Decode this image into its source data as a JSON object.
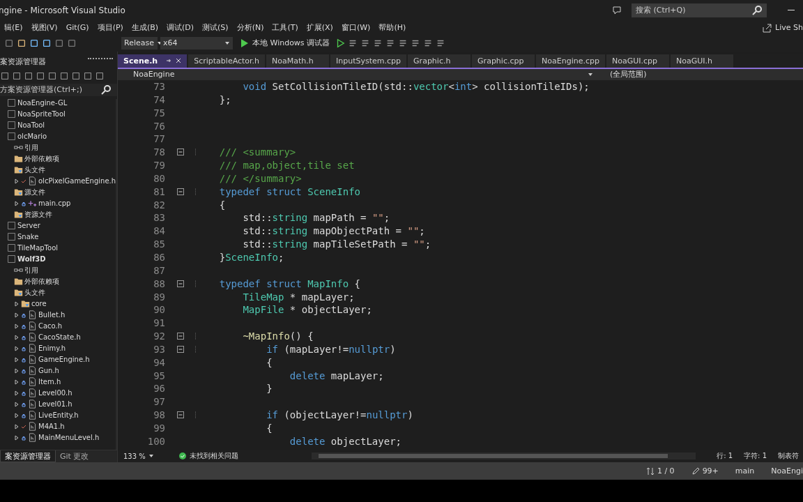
{
  "window": {
    "title": "ngine - Microsoft Visual Studio",
    "search_placeholder": "搜索 (Ctrl+Q)",
    "live_share": "Live Sh"
  },
  "menu": [
    "辑(E)",
    "视图(V)",
    "Git(G)",
    "项目(P)",
    "生成(B)",
    "调试(D)",
    "测试(S)",
    "分析(N)",
    "工具(T)",
    "扩展(X)",
    "窗口(W)",
    "帮助(H)"
  ],
  "toolbar": {
    "configuration": "Release",
    "platform": "x64",
    "debugger": "本地 Windows 调试器"
  },
  "solution_explorer": {
    "title": "案资源管理器",
    "search_placeholder": "方案资源管理器(Ctrl+;)",
    "items": [
      {
        "label": "NoaEngine-GL",
        "kind": "project",
        "startup": false
      },
      {
        "label": "NoaSpriteTool",
        "kind": "project",
        "startup": false
      },
      {
        "label": "NoaTool",
        "kind": "project",
        "startup": false
      },
      {
        "label": "olcMario",
        "kind": "project",
        "startup": false,
        "children": [
          {
            "label": "引用",
            "kind": "ref"
          },
          {
            "label": "外部依赖项",
            "kind": "extdep"
          },
          {
            "label": "头文件",
            "kind": "folder",
            "children": [
              {
                "label": "olcPixelGameEngine.h",
                "kind": "header",
                "locked": false
              }
            ]
          },
          {
            "label": "源文件",
            "kind": "folder",
            "children": [
              {
                "label": "main.cpp",
                "kind": "source",
                "locked": true
              }
            ]
          },
          {
            "label": "资源文件",
            "kind": "folder"
          }
        ]
      },
      {
        "label": "Server",
        "kind": "project",
        "startup": false
      },
      {
        "label": "Snake",
        "kind": "project",
        "startup": false
      },
      {
        "label": "TileMapTool",
        "kind": "project",
        "startup": false
      },
      {
        "label": "Wolf3D",
        "kind": "project",
        "startup": true,
        "children": [
          {
            "label": "引用",
            "kind": "ref"
          },
          {
            "label": "外部依赖项",
            "kind": "extdep"
          },
          {
            "label": "头文件",
            "kind": "folder",
            "children": [
              {
                "label": "core",
                "kind": "folder"
              },
              {
                "label": "Bullet.h",
                "kind": "header",
                "locked": true
              },
              {
                "label": "Caco.h",
                "kind": "header",
                "locked": true
              },
              {
                "label": "CacoState.h",
                "kind": "header",
                "locked": true
              },
              {
                "label": "Enimy.h",
                "kind": "header",
                "locked": true
              },
              {
                "label": "GameEngine.h",
                "kind": "header",
                "locked": true
              },
              {
                "label": "Gun.h",
                "kind": "header",
                "locked": true
              },
              {
                "label": "Item.h",
                "kind": "header",
                "locked": true
              },
              {
                "label": "Level00.h",
                "kind": "header",
                "locked": true
              },
              {
                "label": "Level01.h",
                "kind": "header",
                "locked": true
              },
              {
                "label": "LiveEntity.h",
                "kind": "header",
                "locked": true
              },
              {
                "label": "M4A1.h",
                "kind": "header",
                "locked": false
              },
              {
                "label": "MainMenuLevel.h",
                "kind": "header",
                "locked": true
              }
            ]
          }
        ]
      }
    ],
    "bottom_tabs": [
      {
        "label": "案资源管理器",
        "selected": true
      },
      {
        "label": "Git 更改",
        "selected": false
      }
    ]
  },
  "tabs": [
    {
      "label": "Scene.h",
      "selected": true
    },
    {
      "label": "ScriptableActor.h",
      "selected": false
    },
    {
      "label": "NoaMath.h",
      "selected": false
    },
    {
      "label": "InputSystem.cpp",
      "selected": false
    },
    {
      "label": "Graphic.h",
      "selected": false
    },
    {
      "label": "Graphic.cpp",
      "selected": false
    },
    {
      "label": "NoaEngine.cpp",
      "selected": false
    },
    {
      "label": "NoaGUI.cpp",
      "selected": false
    },
    {
      "label": "NoaGUI.h",
      "selected": false
    }
  ],
  "navigation": {
    "project": "NoaEngine",
    "scope": "(全局范围)"
  },
  "code_lines": [
    {
      "number": "73",
      "fold": false,
      "tokens": [
        {
          "kind": "keyword",
          "text": "        void"
        },
        {
          "kind": "plain",
          "text": " SetCollisionTileID(std::"
        },
        {
          "kind": "type",
          "text": "vector"
        },
        {
          "kind": "plain",
          "text": "<"
        },
        {
          "kind": "keyword",
          "text": "int"
        },
        {
          "kind": "plain",
          "text": "> collisionTileIDs);"
        }
      ]
    },
    {
      "number": "74",
      "fold": false,
      "tokens": [
        {
          "kind": "plain",
          "text": "    };"
        }
      ]
    },
    {
      "number": "75",
      "fold": false
    },
    {
      "number": "76",
      "fold": false
    },
    {
      "number": "77",
      "fold": false
    },
    {
      "number": "78",
      "fold": true,
      "tokens": [
        {
          "kind": "comment",
          "text": "    /// <summary>"
        }
      ]
    },
    {
      "number": "79",
      "fold": false,
      "tokens": [
        {
          "kind": "comment",
          "text": "    /// map,object,tile set"
        }
      ]
    },
    {
      "number": "80",
      "fold": false,
      "tokens": [
        {
          "kind": "comment",
          "text": "    /// </summary>"
        }
      ]
    },
    {
      "number": "81",
      "fold": true,
      "tokens": [
        {
          "kind": "keyword",
          "text": "    typedef struct"
        },
        {
          "kind": "type",
          "text": " SceneInfo"
        }
      ]
    },
    {
      "number": "82",
      "fold": false,
      "tokens": [
        {
          "kind": "plain",
          "text": "    {"
        }
      ]
    },
    {
      "number": "83",
      "fold": false,
      "tokens": [
        {
          "kind": "plain",
          "text": "        std::"
        },
        {
          "kind": "type",
          "text": "string"
        },
        {
          "kind": "plain",
          "text": " mapPath = "
        },
        {
          "kind": "string",
          "text": "\"\""
        },
        {
          "kind": "plain",
          "text": ";"
        }
      ]
    },
    {
      "number": "84",
      "fold": false,
      "tokens": [
        {
          "kind": "plain",
          "text": "        std::"
        },
        {
          "kind": "type",
          "text": "string"
        },
        {
          "kind": "plain",
          "text": " mapObjectPath = "
        },
        {
          "kind": "string",
          "text": "\"\""
        },
        {
          "kind": "plain",
          "text": ";"
        }
      ]
    },
    {
      "number": "85",
      "fold": false,
      "tokens": [
        {
          "kind": "plain",
          "text": "        std::"
        },
        {
          "kind": "type",
          "text": "string"
        },
        {
          "kind": "plain",
          "text": " mapTileSetPath = "
        },
        {
          "kind": "string",
          "text": "\"\""
        },
        {
          "kind": "plain",
          "text": ";"
        }
      ]
    },
    {
      "number": "86",
      "fold": false,
      "tokens": [
        {
          "kind": "plain",
          "text": "    }"
        },
        {
          "kind": "type",
          "text": "SceneInfo"
        },
        {
          "kind": "plain",
          "text": ";"
        }
      ]
    },
    {
      "number": "87",
      "fold": false
    },
    {
      "number": "88",
      "fold": true,
      "tokens": [
        {
          "kind": "keyword",
          "text": "    typedef struct"
        },
        {
          "kind": "type",
          "text": " MapInfo"
        },
        {
          "kind": "plain",
          "text": " {"
        }
      ]
    },
    {
      "number": "89",
      "fold": false,
      "tokens": [
        {
          "kind": "type",
          "text": "        TileMap"
        },
        {
          "kind": "plain",
          "text": " * mapLayer;"
        }
      ]
    },
    {
      "number": "90",
      "fold": false,
      "tokens": [
        {
          "kind": "type",
          "text": "        MapFile"
        },
        {
          "kind": "plain",
          "text": " * objectLayer;"
        }
      ]
    },
    {
      "number": "91",
      "fold": false
    },
    {
      "number": "92",
      "fold": true,
      "tokens": [
        {
          "kind": "function",
          "text": "        ~MapInfo"
        },
        {
          "kind": "plain",
          "text": "() {"
        }
      ]
    },
    {
      "number": "93",
      "fold": true,
      "tokens": [
        {
          "kind": "keyword",
          "text": "            if"
        },
        {
          "kind": "plain",
          "text": " (mapLayer!="
        },
        {
          "kind": "keyword",
          "text": "nullptr"
        },
        {
          "kind": "plain",
          "text": ")"
        }
      ]
    },
    {
      "number": "94",
      "fold": false,
      "tokens": [
        {
          "kind": "plain",
          "text": "            {"
        }
      ]
    },
    {
      "number": "95",
      "fold": false,
      "tokens": [
        {
          "kind": "keyword",
          "text": "                delete"
        },
        {
          "kind": "plain",
          "text": " mapLayer;"
        }
      ]
    },
    {
      "number": "96",
      "fold": false,
      "tokens": [
        {
          "kind": "plain",
          "text": "            }"
        }
      ]
    },
    {
      "number": "97",
      "fold": false
    },
    {
      "number": "98",
      "fold": true,
      "tokens": [
        {
          "kind": "keyword",
          "text": "            if"
        },
        {
          "kind": "plain",
          "text": " (objectLayer!="
        },
        {
          "kind": "keyword",
          "text": "nullptr"
        },
        {
          "kind": "plain",
          "text": ")"
        }
      ]
    },
    {
      "number": "99",
      "fold": false,
      "tokens": [
        {
          "kind": "plain",
          "text": "            {"
        }
      ]
    },
    {
      "number": "100",
      "fold": false,
      "tokens": [
        {
          "kind": "keyword",
          "text": "                delete"
        },
        {
          "kind": "plain",
          "text": " objectLayer;"
        }
      ]
    }
  ],
  "editor_status": {
    "zoom": "133 %",
    "issues": "未找到相关问题",
    "line": "行: 1",
    "char": "字符: 1",
    "indent": "制表符"
  },
  "status_bar": {
    "changes": "1 / 0",
    "edits": "99+",
    "branch": "main",
    "repo": "NoaEngi"
  }
}
